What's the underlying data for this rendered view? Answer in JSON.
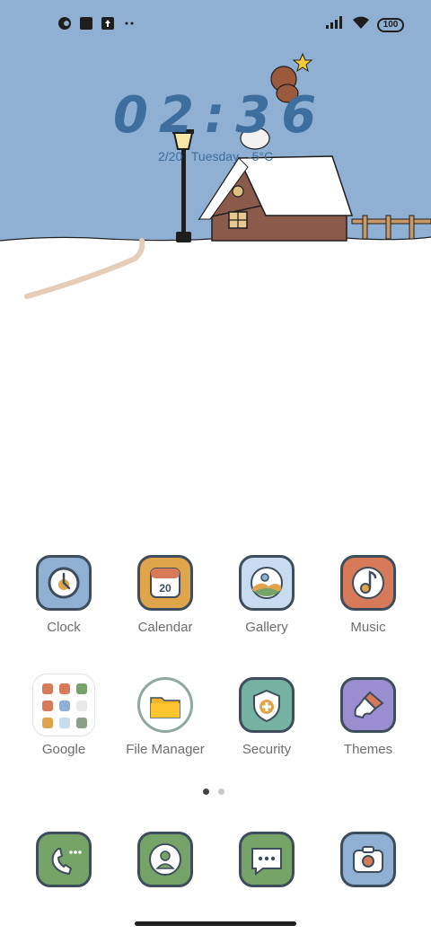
{
  "status_bar": {
    "battery_level": "100",
    "left_icons": [
      "app-notification-icon",
      "square-notification-icon",
      "upload-notification-icon",
      "more-dots-icon"
    ],
    "right_icons": [
      "signal-icon",
      "wifi-icon",
      "battery-icon"
    ]
  },
  "clock_widget": {
    "time": "02:36",
    "date": "2/20",
    "weekday": "Tuesday",
    "temperature": "-5°C"
  },
  "apps": [
    {
      "label": "Clock",
      "icon": "clock-icon",
      "color": "#8fb0d2"
    },
    {
      "label": "Calendar",
      "icon": "calendar-icon",
      "color": "#e0a44a",
      "badge": "20"
    },
    {
      "label": "Gallery",
      "icon": "gallery-icon",
      "color": "#c9dcef"
    },
    {
      "label": "Music",
      "icon": "music-icon",
      "color": "#d77a5a"
    },
    {
      "label": "Google",
      "icon": "google-folder-icon",
      "color": "#ffffff"
    },
    {
      "label": "File Manager",
      "icon": "folder-icon",
      "color": "#ffffff"
    },
    {
      "label": "Security",
      "icon": "shield-icon",
      "color": "#76b2a2"
    },
    {
      "label": "Themes",
      "icon": "brush-icon",
      "color": "#9b8ed0"
    }
  ],
  "dock": [
    {
      "name": "phone",
      "icon": "phone-icon",
      "color": "#76a368"
    },
    {
      "name": "contacts",
      "icon": "contacts-icon",
      "color": "#76a368"
    },
    {
      "name": "messages",
      "icon": "message-icon",
      "color": "#76a368"
    },
    {
      "name": "camera",
      "icon": "camera-icon",
      "color": "#8fb0d2"
    }
  ],
  "page_indicator": {
    "pages": 2,
    "current": 1
  }
}
